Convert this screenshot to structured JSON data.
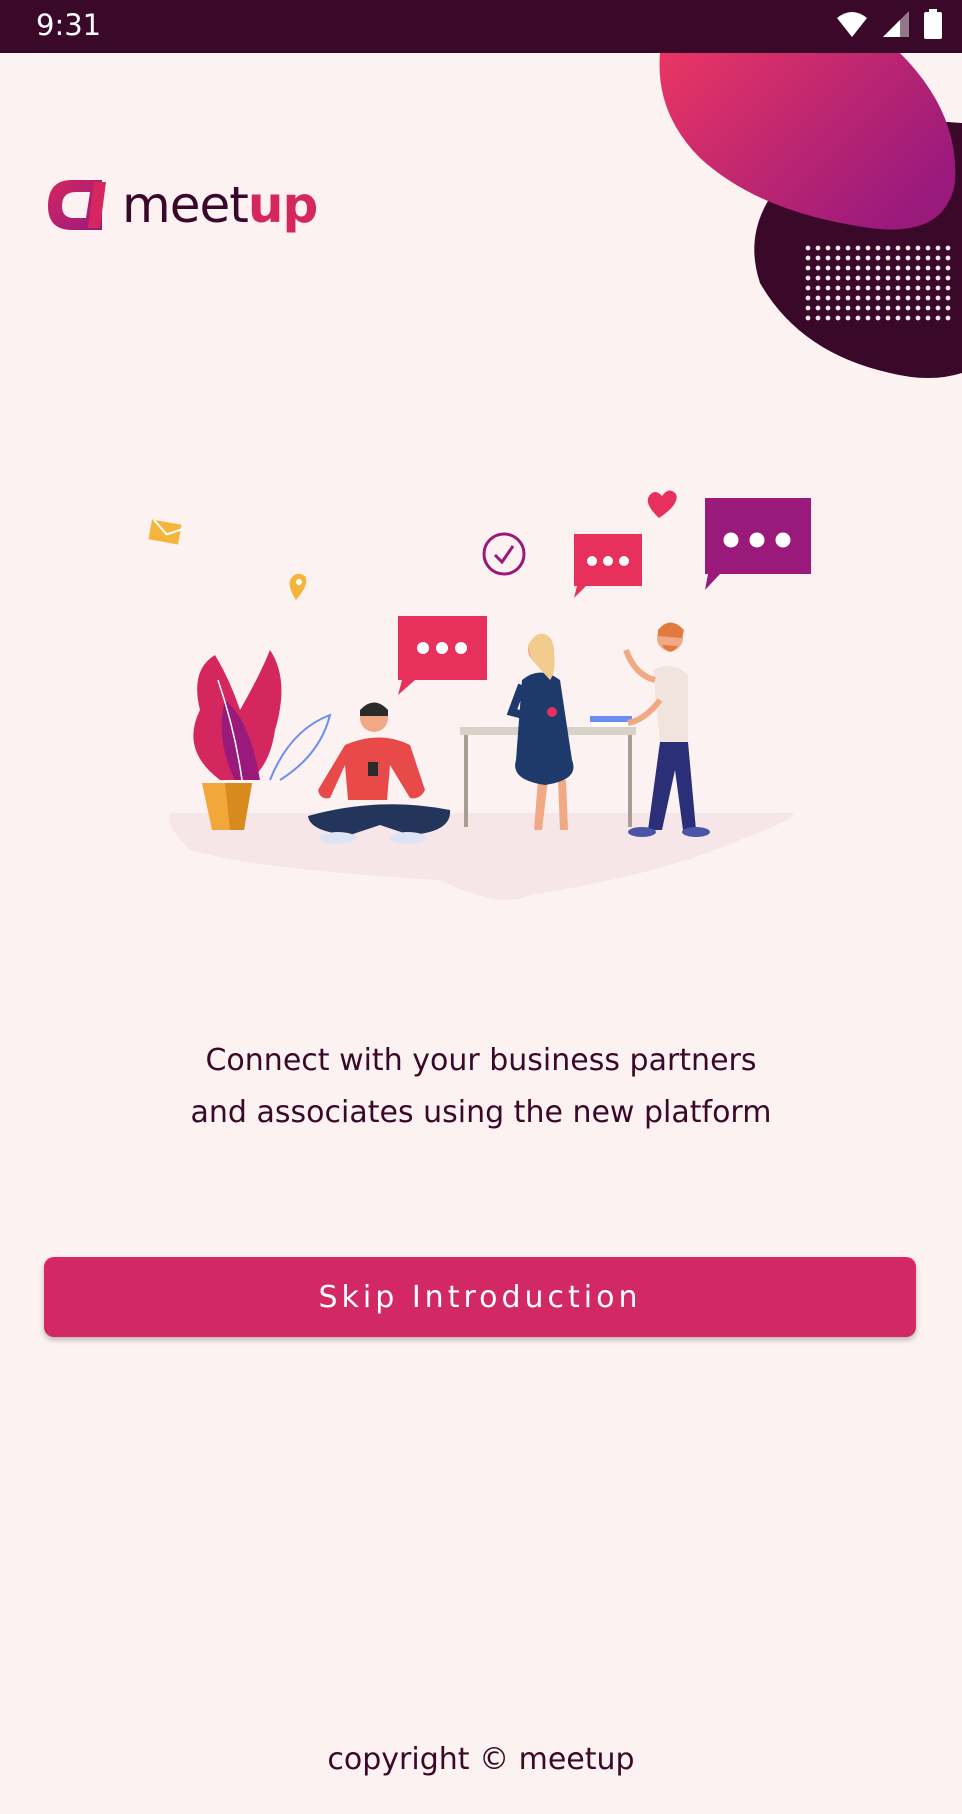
{
  "status_bar": {
    "time": "9:31",
    "icons": [
      "wifi-icon",
      "signal-icon",
      "battery-icon"
    ]
  },
  "brand": {
    "name_part1": "meet",
    "name_part2": "up",
    "logo_icon": "meetup-logo-mark"
  },
  "illustration": {
    "description_icon": "team-collaboration-illustration"
  },
  "tagline": {
    "line1": "Connect with your business partners",
    "line2": "and associates using the new platform"
  },
  "actions": {
    "skip_label": "Skip Introduction"
  },
  "footer": {
    "copyright": "copyright © meetup"
  },
  "colors": {
    "background": "#fdf2f2",
    "status_bar": "#3a0828",
    "primary": "#d22863",
    "text": "#3a0828",
    "gradient_start": "#e83060",
    "gradient_end": "#9b1a7a"
  }
}
